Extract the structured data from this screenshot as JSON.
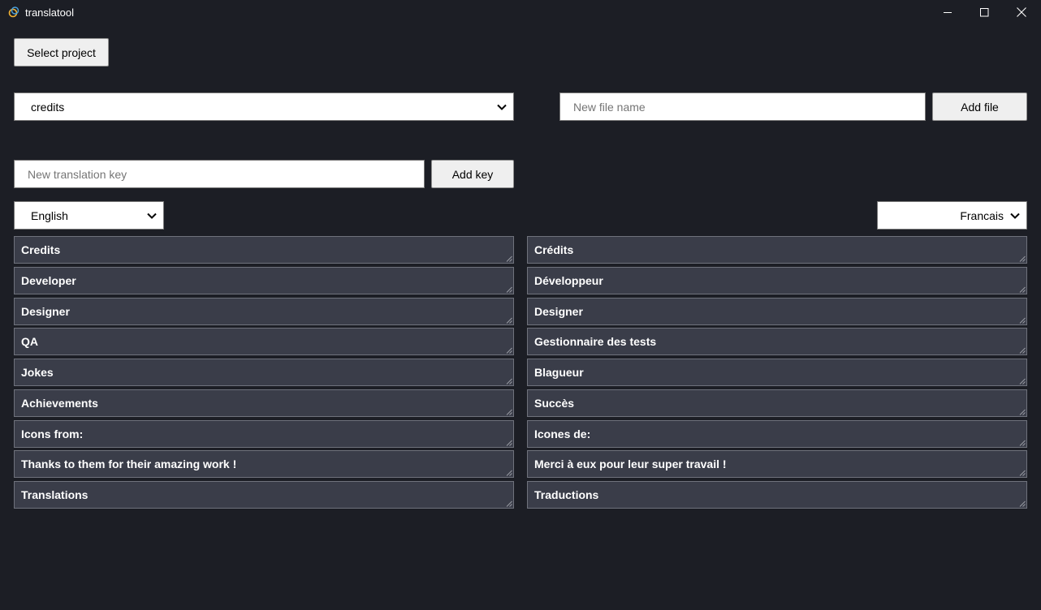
{
  "window": {
    "title": "translatool"
  },
  "toolbar": {
    "select_project_label": "Select project"
  },
  "file": {
    "selected": "credits",
    "new_file_placeholder": "New file name",
    "add_file_label": "Add file"
  },
  "key": {
    "new_key_placeholder": "New translation key",
    "add_key_label": "Add key"
  },
  "languages": {
    "left": "English",
    "right": "Francais"
  },
  "rows": [
    {
      "en": "Credits",
      "fr": "Crédits"
    },
    {
      "en": "Developer",
      "fr": "Développeur"
    },
    {
      "en": "Designer",
      "fr": "Designer"
    },
    {
      "en": "QA",
      "fr": "Gestionnaire des tests"
    },
    {
      "en": "Jokes",
      "fr": "Blagueur"
    },
    {
      "en": "Achievements",
      "fr": "Succès"
    },
    {
      "en": "Icons from:",
      "fr": "Icones de:"
    },
    {
      "en": "Thanks to them for their amazing work !",
      "fr": "Merci à eux pour leur super travail !"
    },
    {
      "en": "Translations",
      "fr": "Traductions"
    }
  ]
}
